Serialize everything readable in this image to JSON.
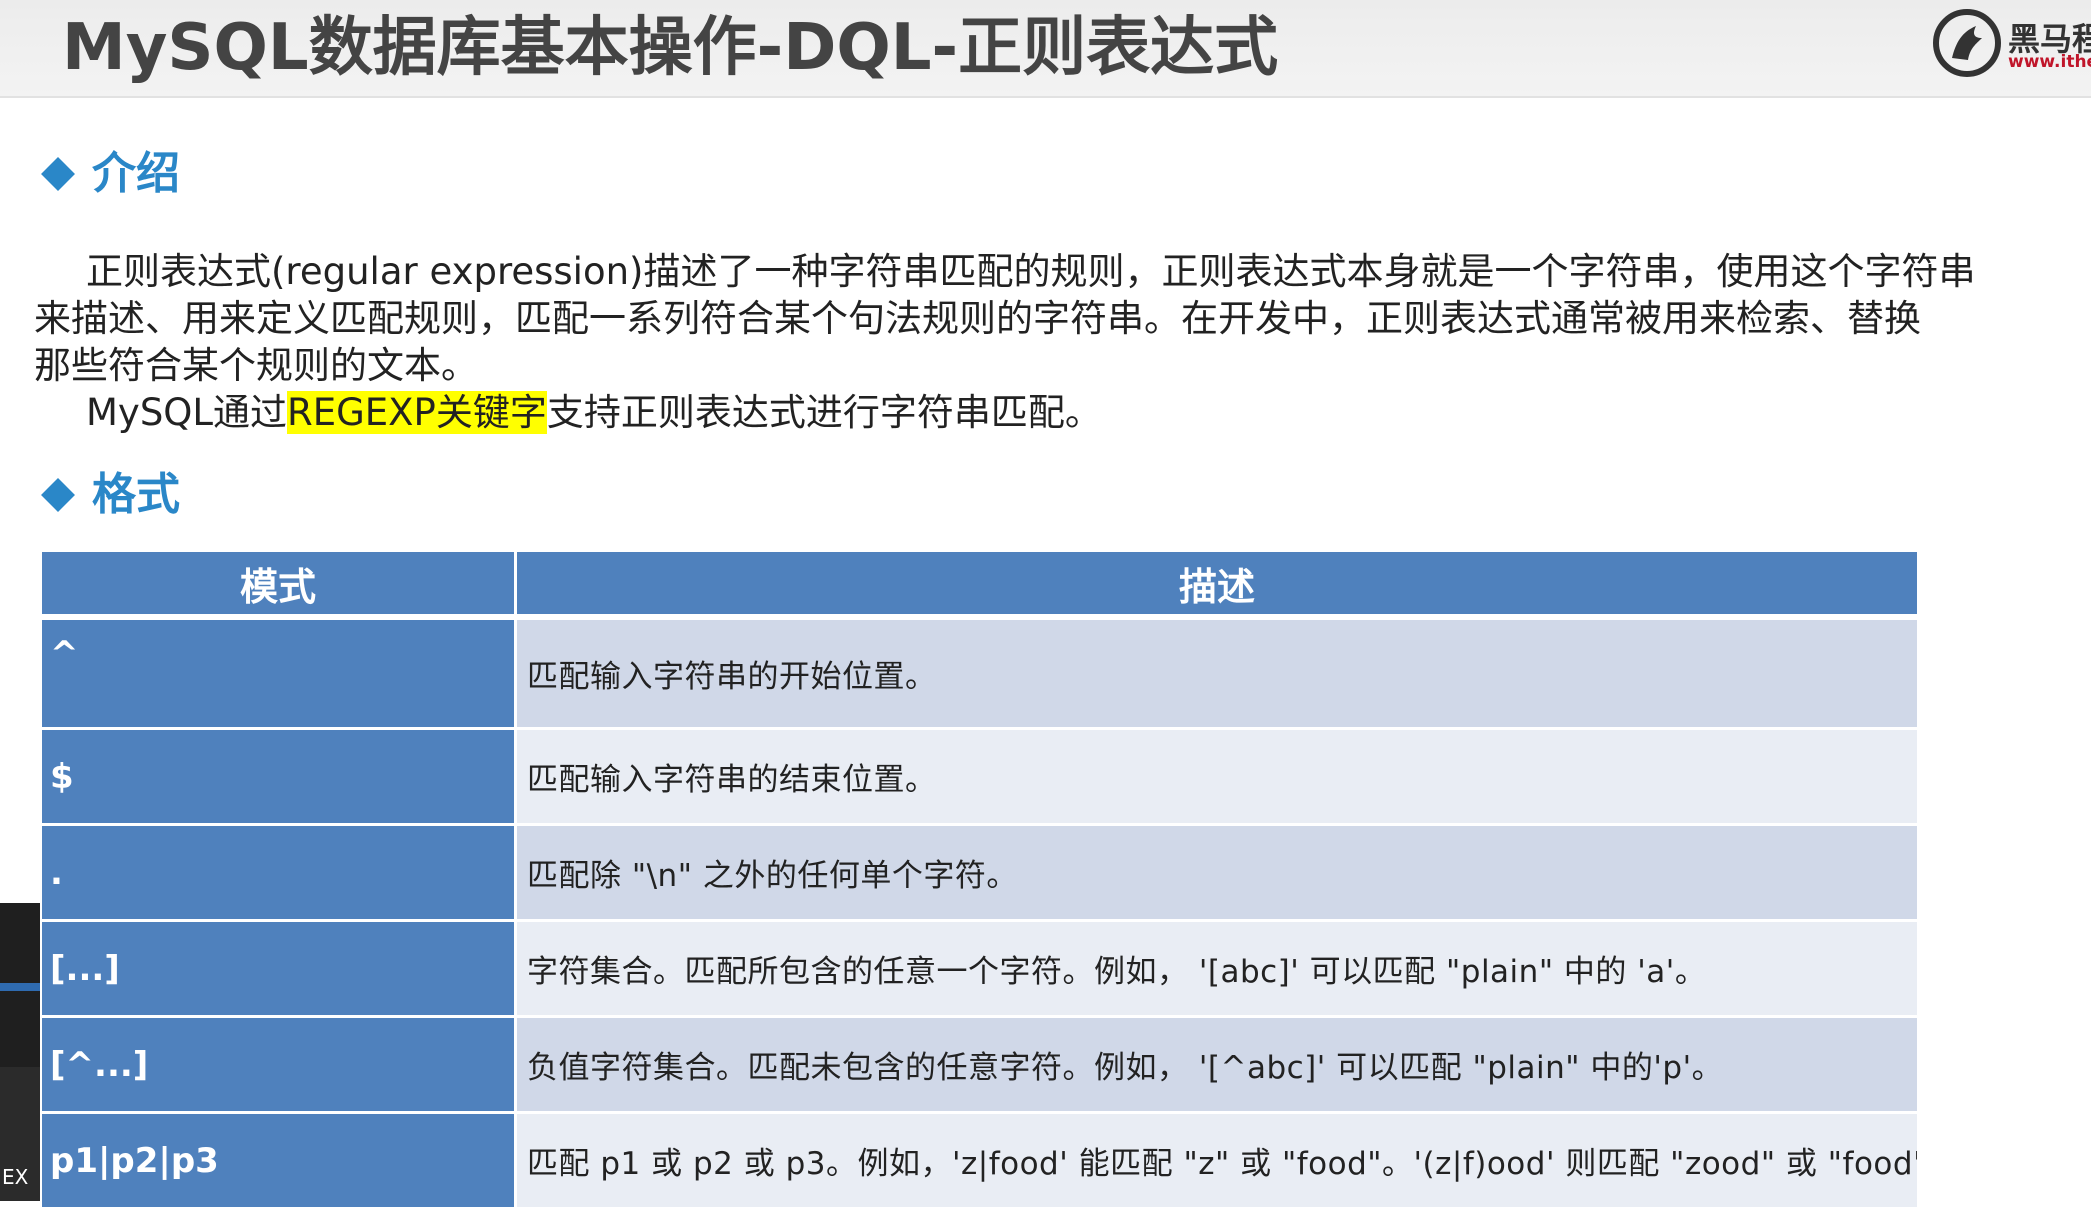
{
  "header": {
    "title": "MySQL数据库基本操作-DQL-正则表达式",
    "logo": {
      "name": "黑马程",
      "url": "www.ithei"
    }
  },
  "sections": {
    "intro": {
      "title": "介绍",
      "lines": [
        "正则表达式(regular expression)描述了一种字符串匹配的规则，正则表达式本身就是一个字符串，使用这个字符串",
        "来描述、用来定义匹配规则，匹配一系列符合某个句法规则的字符串。在开发中，正则表达式通常被用来检索、替换",
        "那些符合某个规则的文本。"
      ],
      "regexp_line": {
        "before": "MySQL通过",
        "highlight": "REGEXP关键字",
        "after": "支持正则表达式进行字符串匹配。"
      }
    },
    "format": {
      "title": "格式"
    }
  },
  "table": {
    "headers": {
      "pattern": "模式",
      "description": "描述"
    },
    "rows": [
      {
        "pattern": "^",
        "description": "匹配输入字符串的开始位置。"
      },
      {
        "pattern": "$",
        "description": "匹配输入字符串的结束位置。"
      },
      {
        "pattern": ".",
        "description": "匹配除 \"\\n\" 之外的任何单个字符。"
      },
      {
        "pattern": "[...]",
        "description": "字符集合。匹配所包含的任意一个字符。例如， '[abc]' 可以匹配 \"plain\" 中的 'a'。"
      },
      {
        "pattern": "[^...]",
        "description": "负值字符集合。匹配未包含的任意字符。例如， '[^abc]' 可以匹配 \"plain\" 中的'p'。"
      },
      {
        "pattern": "p1|p2|p3",
        "description": "匹配 p1 或 p2 或 p3。例如，'z|food' 能匹配 \"z\" 或 \"food\"。'(z|f)ood' 则匹配 \"zood\" 或 \"food\"。"
      }
    ]
  },
  "side_fragment": {
    "text": "EX"
  },
  "colors": {
    "accent_blue": "#2a87c8",
    "table_header": "#4f81bd",
    "row_band_dark": "#d0d8e8",
    "row_band_light": "#e9edf4",
    "highlight": "#ffff00",
    "logo_red": "#c0152a"
  }
}
